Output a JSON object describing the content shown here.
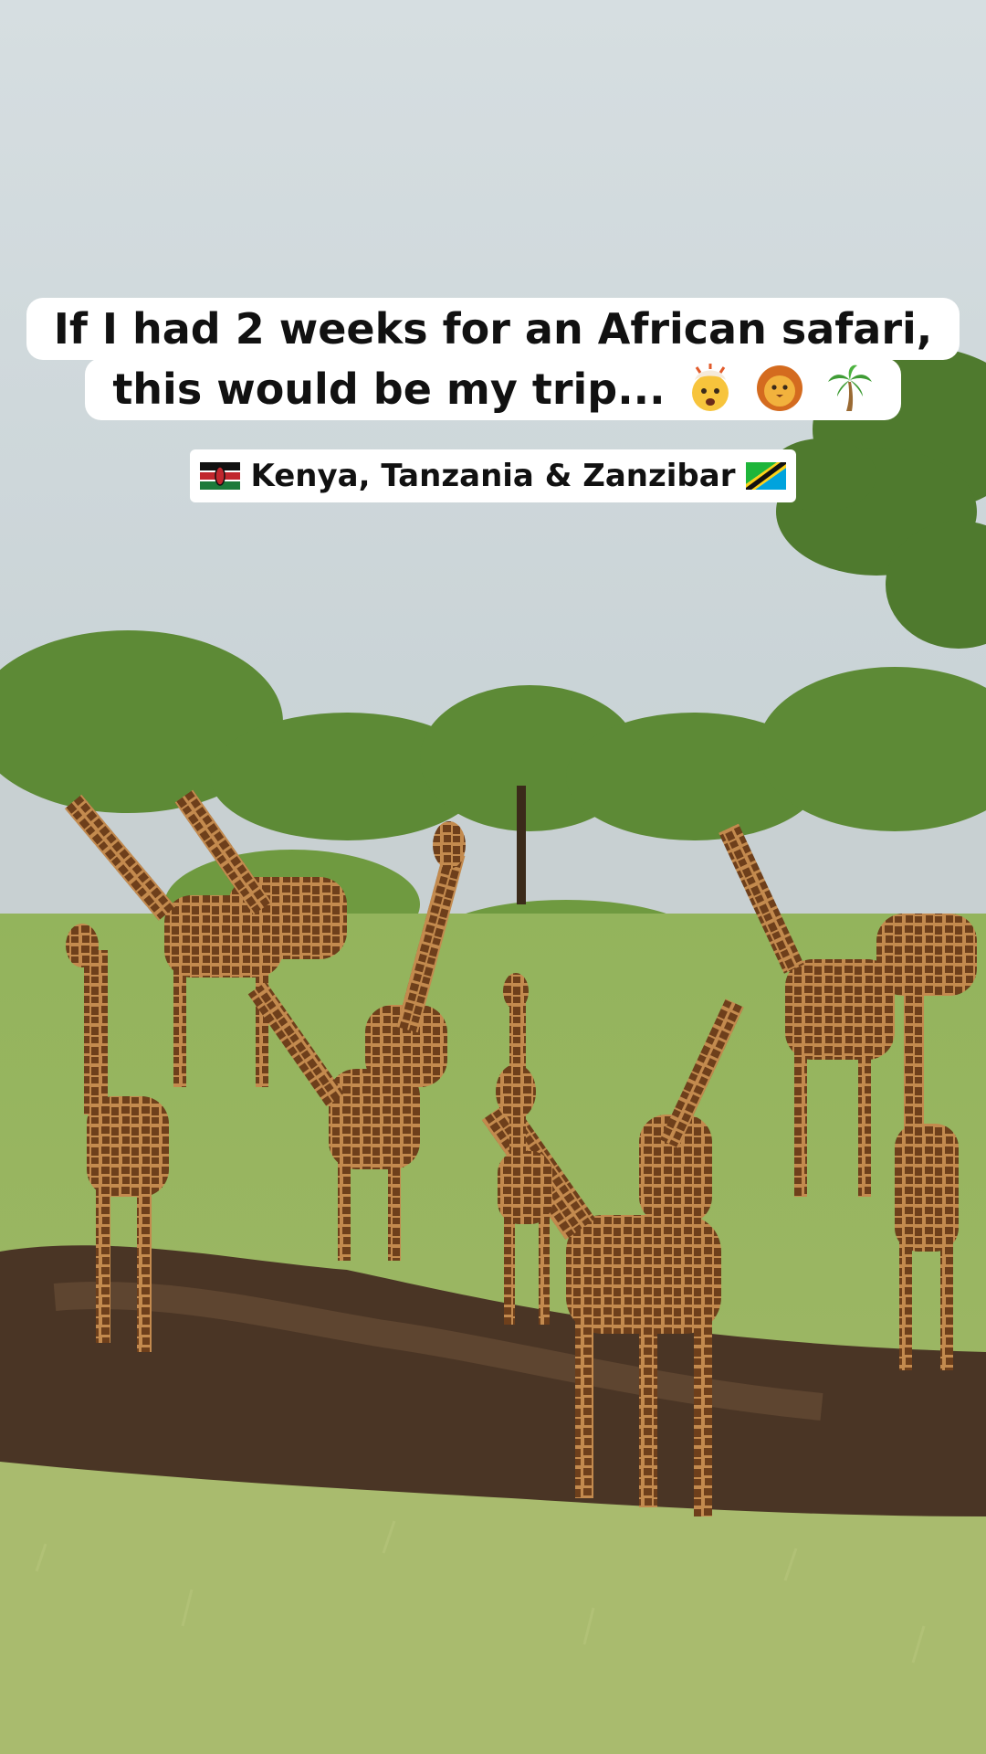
{
  "video": {
    "caption_line1": "If I had 2 weeks for an African safari,",
    "caption_line2": "this would be my trip...",
    "caption_emojis": [
      "exploding-head-emoji",
      "lion-face-emoji",
      "palm-tree-emoji"
    ],
    "subcaption": "Kenya, Tanzania & Zanzibar",
    "subcaption_flags": [
      "kenya-flag",
      "tanzania-flag"
    ]
  },
  "colors": {
    "sky": "#d2dbde",
    "grass": "#8fb35a",
    "giraffe_body": "#b07a44",
    "giraffe_patch": "#6b3f1c",
    "caption_bg": "#ffffff",
    "caption_text": "#111111"
  }
}
